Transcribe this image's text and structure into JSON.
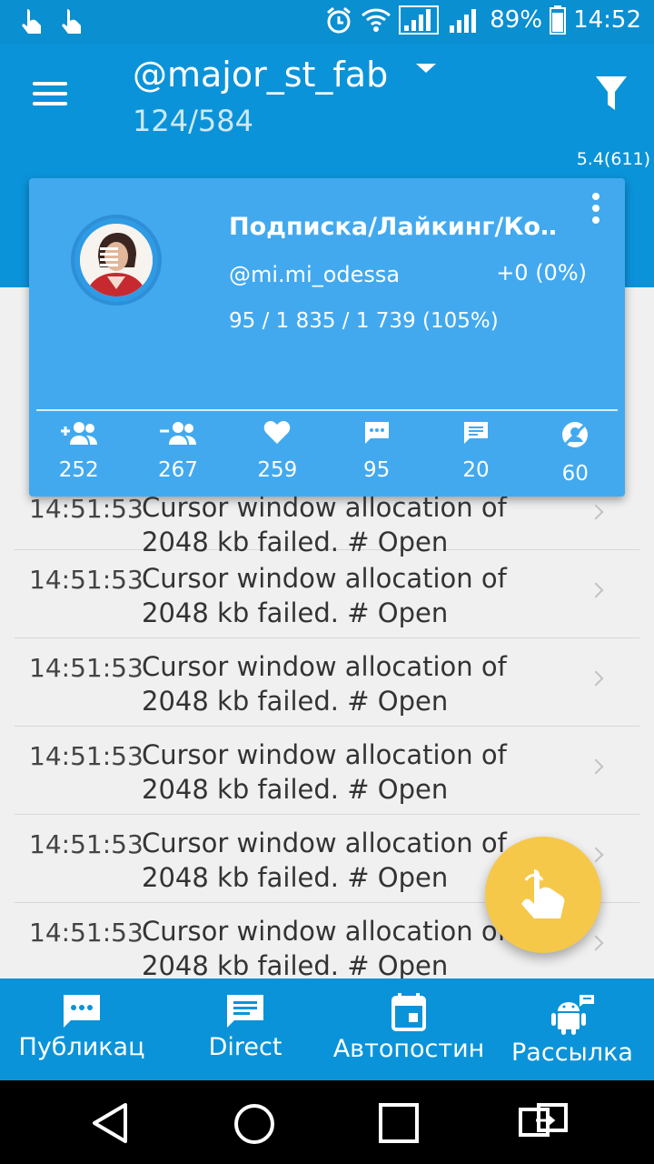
{
  "status_bar": {
    "battery": "89%",
    "time": "14:52",
    "icons": [
      "touch-icon",
      "touch-icon",
      "alarm-icon",
      "wifi-icon",
      "signal-icon",
      "signal-icon",
      "battery-icon"
    ]
  },
  "header": {
    "account": "@major_st_fab",
    "counts": "124/584",
    "version": "5.4(611)"
  },
  "card": {
    "title": "Подписка/Лайкинг/Ко…",
    "username": "@mi.mi_odessa",
    "delta": "+0 (0%)",
    "ratio": "95 / 1 835 / 1 739 (105%)",
    "stats": [
      {
        "icon": "add-person-icon",
        "value": "252"
      },
      {
        "icon": "remove-person-icon",
        "value": "267"
      },
      {
        "icon": "heart-icon",
        "value": "259"
      },
      {
        "icon": "comment-icon",
        "value": "95"
      },
      {
        "icon": "message-icon",
        "value": "20"
      },
      {
        "icon": "unfollow-icon",
        "value": "60"
      }
    ]
  },
  "log": {
    "items": [
      {
        "time": "14:51:53",
        "text": "Cursor window allocation of 2048 kb failed. # Open"
      },
      {
        "time": "14:51:53",
        "text": "Cursor window allocation of 2048 kb failed. # Open"
      },
      {
        "time": "14:51:53",
        "text": "Cursor window allocation of 2048 kb failed. # Open"
      },
      {
        "time": "14:51:53",
        "text": "Cursor window allocation of 2048 kb failed. # Open"
      },
      {
        "time": "14:51:53",
        "text": "Cursor window allocation of 2048 kb failed. # Open"
      },
      {
        "time": "14:51:53",
        "text": "Cursor window allocation of 2048 kb failed. # Open"
      }
    ]
  },
  "bottom_nav": {
    "items": [
      {
        "label": "Публикац",
        "icon": "chat-bubble-icon"
      },
      {
        "label": "Direct",
        "icon": "message-icon"
      },
      {
        "label": "Автопостин",
        "icon": "calendar-icon"
      },
      {
        "label": "Рассылка",
        "icon": "android-icon"
      }
    ]
  },
  "colors": {
    "primary": "#0b93d9",
    "card": "#42a9ef",
    "fab": "#f6c84a"
  }
}
